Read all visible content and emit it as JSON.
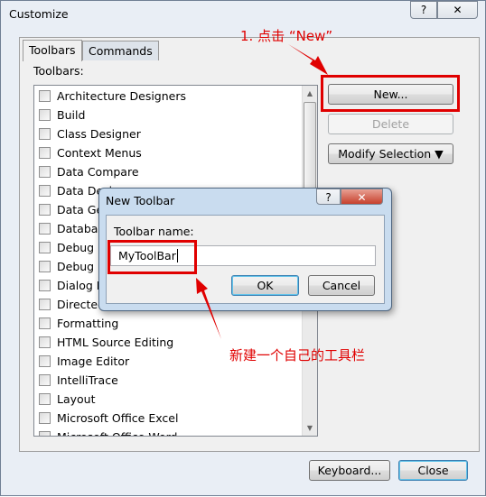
{
  "window": {
    "title": "Customize",
    "help_icon": "question-icon",
    "close_icon": "close-icon"
  },
  "tabs": [
    {
      "label": "Toolbars"
    },
    {
      "label": "Commands"
    }
  ],
  "toolbars_label": "Toolbars:",
  "toolbars": [
    "Architecture Designers",
    "Build",
    "Class Designer",
    "Context Menus",
    "Data Compare",
    "Data Design",
    "Data Generator",
    "Database",
    "Debug",
    "Debug Location",
    "Dialog Editor",
    "Directed Graph",
    "Formatting",
    "HTML Source Editing",
    "Image Editor",
    "IntelliTrace",
    "Layout",
    "Microsoft Office Excel",
    "Microsoft Office Word"
  ],
  "buttons": {
    "new": "New...",
    "delete": "Delete",
    "modify": "Modify Selection ▼",
    "keyboard": "Keyboard...",
    "close": "Close"
  },
  "dialog": {
    "title": "New Toolbar",
    "label": "Toolbar name:",
    "value": "MyToolBar",
    "ok": "OK",
    "cancel": "Cancel"
  },
  "annotations": {
    "step1": "1. 点击 “New”",
    "step2": "新建一个自己的工具栏",
    "color": "#e00000"
  }
}
